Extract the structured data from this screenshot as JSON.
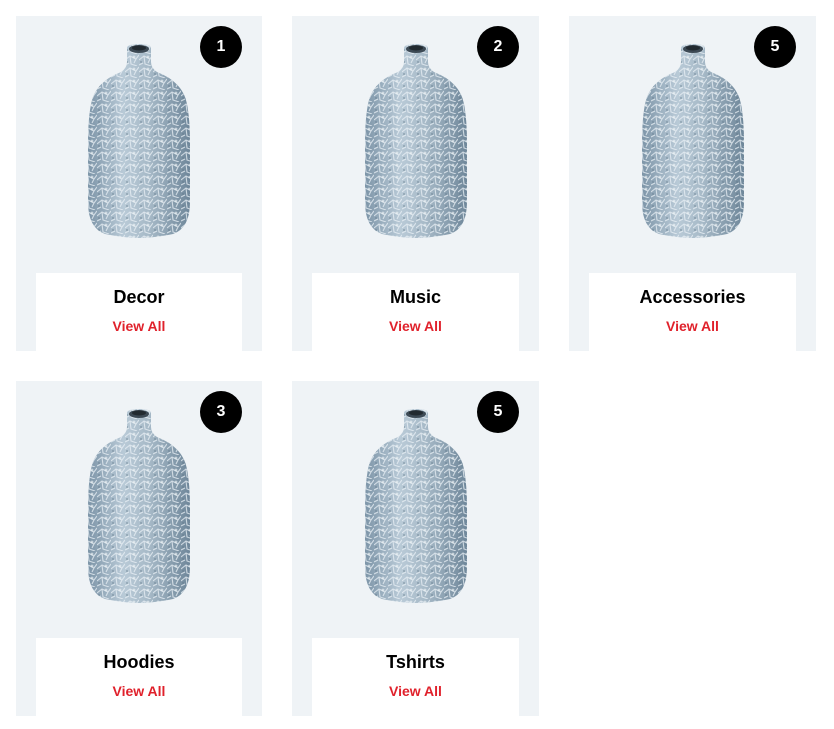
{
  "categories": [
    {
      "name": "Decor",
      "count": "1",
      "link_label": "View All"
    },
    {
      "name": "Music",
      "count": "2",
      "link_label": "View All"
    },
    {
      "name": "Accessories",
      "count": "5",
      "link_label": "View All"
    },
    {
      "name": "Hoodies",
      "count": "3",
      "link_label": "View All"
    },
    {
      "name": "Tshirts",
      "count": "5",
      "link_label": "View All"
    }
  ],
  "colors": {
    "card_background": "#eff3f6",
    "badge_background": "#000000",
    "link_color": "#e0212b"
  }
}
